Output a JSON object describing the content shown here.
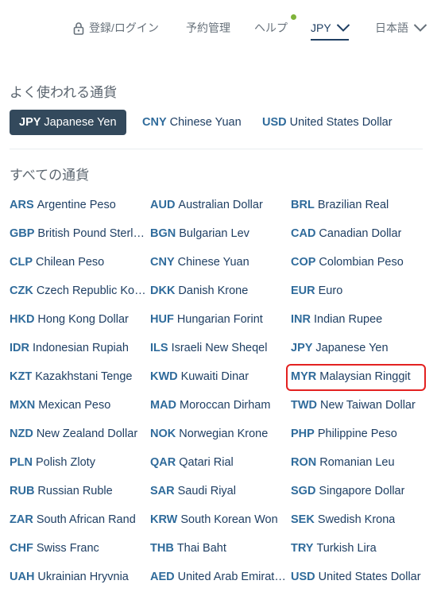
{
  "nav": {
    "login_label": "登録/ログイン",
    "reservations_label": "予約管理",
    "help_label": "ヘルプ",
    "currency_label": "JPY",
    "language_label": "日本語",
    "notification_dot_color": "#7fb33a"
  },
  "favorites": {
    "title": "よく使われる通貨",
    "items": [
      {
        "code": "JPY",
        "name": "Japanese Yen",
        "selected": true
      },
      {
        "code": "CNY",
        "name": "Chinese Yuan",
        "selected": false
      },
      {
        "code": "USD",
        "name": "United States Dollar",
        "selected": false
      }
    ]
  },
  "all_currencies": {
    "title": "すべての通貨",
    "highlighted_code": "MYR",
    "items": [
      {
        "code": "ARS",
        "name": "Argentine Peso"
      },
      {
        "code": "AUD",
        "name": "Australian Dollar"
      },
      {
        "code": "BRL",
        "name": "Brazilian Real"
      },
      {
        "code": "GBP",
        "name": "British Pound Sterling"
      },
      {
        "code": "BGN",
        "name": "Bulgarian Lev"
      },
      {
        "code": "CAD",
        "name": "Canadian Dollar"
      },
      {
        "code": "CLP",
        "name": "Chilean Peso"
      },
      {
        "code": "CNY",
        "name": "Chinese Yuan"
      },
      {
        "code": "COP",
        "name": "Colombian Peso"
      },
      {
        "code": "CZK",
        "name": "Czech Republic Koruna"
      },
      {
        "code": "DKK",
        "name": "Danish Krone"
      },
      {
        "code": "EUR",
        "name": "Euro"
      },
      {
        "code": "HKD",
        "name": "Hong Kong Dollar"
      },
      {
        "code": "HUF",
        "name": "Hungarian Forint"
      },
      {
        "code": "INR",
        "name": "Indian Rupee"
      },
      {
        "code": "IDR",
        "name": "Indonesian Rupiah"
      },
      {
        "code": "ILS",
        "name": "Israeli New Sheqel"
      },
      {
        "code": "JPY",
        "name": "Japanese Yen"
      },
      {
        "code": "KZT",
        "name": "Kazakhstani Tenge"
      },
      {
        "code": "KWD",
        "name": "Kuwaiti Dinar"
      },
      {
        "code": "MYR",
        "name": "Malaysian Ringgit"
      },
      {
        "code": "MXN",
        "name": "Mexican Peso"
      },
      {
        "code": "MAD",
        "name": "Moroccan Dirham"
      },
      {
        "code": "TWD",
        "name": "New Taiwan Dollar"
      },
      {
        "code": "NZD",
        "name": "New Zealand Dollar"
      },
      {
        "code": "NOK",
        "name": "Norwegian Krone"
      },
      {
        "code": "PHP",
        "name": "Philippine Peso"
      },
      {
        "code": "PLN",
        "name": "Polish Zloty"
      },
      {
        "code": "QAR",
        "name": "Qatari Rial"
      },
      {
        "code": "RON",
        "name": "Romanian Leu"
      },
      {
        "code": "RUB",
        "name": "Russian Ruble"
      },
      {
        "code": "SAR",
        "name": "Saudi Riyal"
      },
      {
        "code": "SGD",
        "name": "Singapore Dollar"
      },
      {
        "code": "ZAR",
        "name": "South African Rand"
      },
      {
        "code": "KRW",
        "name": "South Korean Won"
      },
      {
        "code": "SEK",
        "name": "Swedish Krona"
      },
      {
        "code": "CHF",
        "name": "Swiss Franc"
      },
      {
        "code": "THB",
        "name": "Thai Baht"
      },
      {
        "code": "TRY",
        "name": "Turkish Lira"
      },
      {
        "code": "UAH",
        "name": "Ukrainian Hryvnia"
      },
      {
        "code": "AED",
        "name": "United Arab Emirates Dirham"
      },
      {
        "code": "USD",
        "name": "United States Dollar"
      }
    ]
  }
}
